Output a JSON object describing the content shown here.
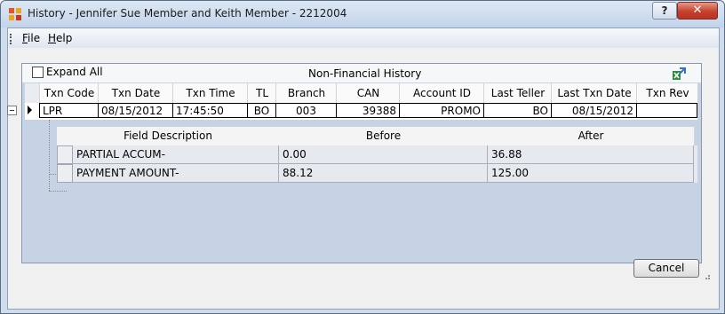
{
  "window": {
    "title": "History - Jennifer Sue Member and Keith Member - 2212004",
    "help_button": "?",
    "close_button": "✕"
  },
  "menu": {
    "file_hotkey": "F",
    "file_rest": "ile",
    "help_hotkey": "H",
    "help_rest": "elp"
  },
  "panel": {
    "expand_all_label": "Expand All",
    "expand_all_checked": false,
    "title": "Non-Financial History",
    "export_icon": "excel-export-icon"
  },
  "grid": {
    "columns": [
      "Txn Code",
      "Txn Date",
      "Txn Time",
      "TL",
      "Branch",
      "CAN",
      "Account ID",
      "Last Teller",
      "Last Txn Date",
      "Txn Rev"
    ],
    "rows": [
      {
        "txn_code": "LPR",
        "txn_date": "08/15/2012",
        "txn_time": "17:45:50",
        "tl": "BO",
        "branch": "003",
        "can": "39388",
        "account_id": "PROMO",
        "last_teller": "BO",
        "last_txn_date": "08/15/2012",
        "txn_rev": ""
      }
    ]
  },
  "detail": {
    "columns": [
      "Field Description",
      "Before",
      "After"
    ],
    "rows": [
      {
        "field": "PARTIAL ACCUM-",
        "before": "0.00",
        "after": "36.88"
      },
      {
        "field": "PAYMENT AMOUNT-",
        "before": "88.12",
        "after": "125.00"
      }
    ]
  },
  "footer": {
    "cancel_label": "Cancel"
  }
}
